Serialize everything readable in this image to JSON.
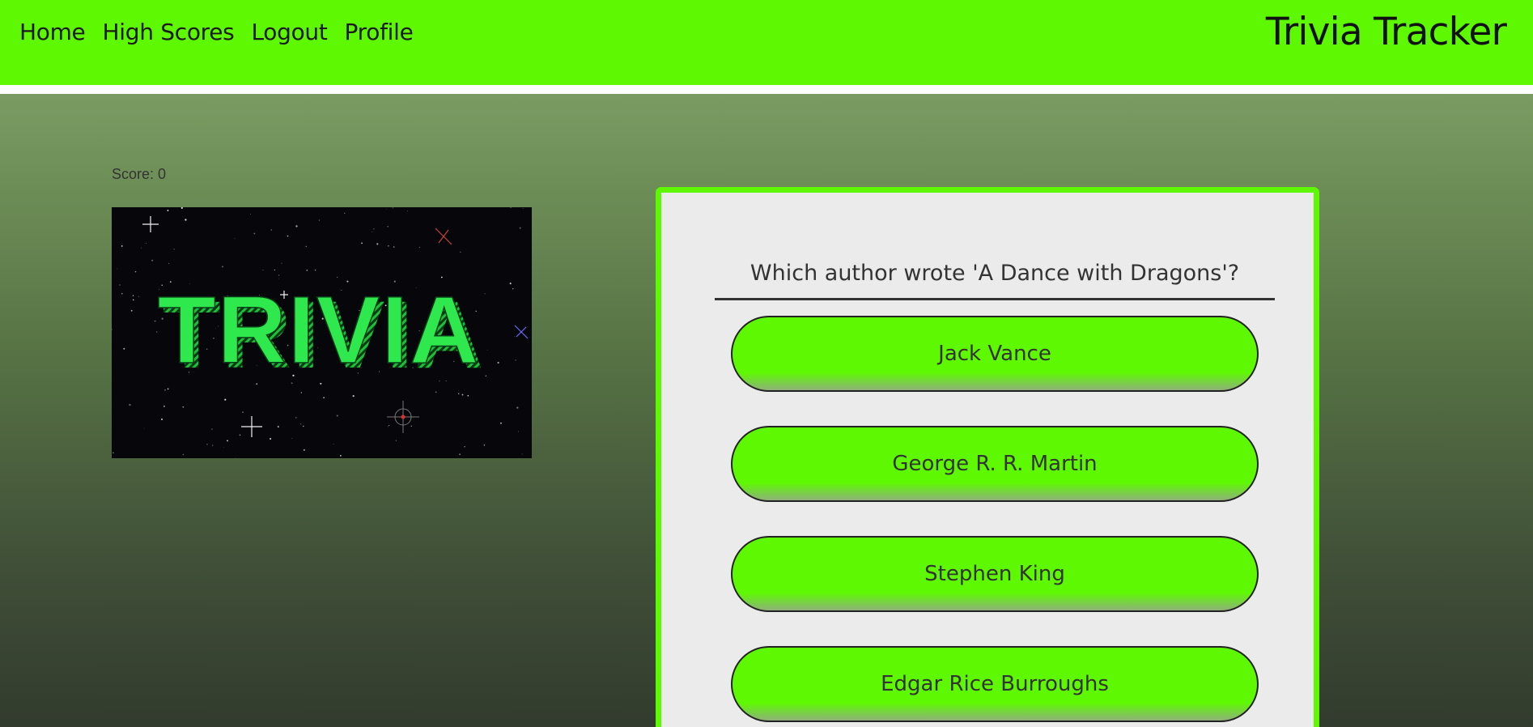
{
  "nav": {
    "links": [
      {
        "label": "Home"
      },
      {
        "label": "High Scores"
      },
      {
        "label": "Logout"
      },
      {
        "label": "Profile"
      }
    ],
    "brand": "Trivia Tracker"
  },
  "game": {
    "score_text": "Score: 0",
    "image_text": "TRIVIA",
    "question": "Which author wrote 'A Dance with Dragons'?",
    "answers": [
      {
        "label": "Jack Vance"
      },
      {
        "label": "George R. R. Martin"
      },
      {
        "label": "Stephen King"
      },
      {
        "label": "Edgar Rice Burroughs"
      }
    ]
  },
  "colors": {
    "accent": "#5ff803",
    "card_background": "#ebebeb"
  }
}
